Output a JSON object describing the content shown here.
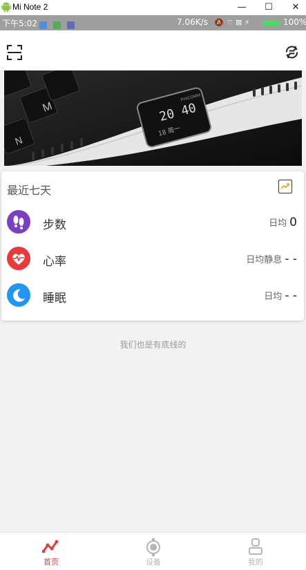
{
  "window": {
    "title": "Mi Note 2",
    "minimize": "—",
    "maximize": "☐",
    "close": "✕"
  },
  "status_bar": {
    "time": "下午5:02",
    "net_speed": "7.06K/s",
    "battery": "100%"
  },
  "summary": {
    "title": "最近七天",
    "rows": [
      {
        "label": "步数",
        "metric_label": "日均",
        "metric_value": "0",
        "color": "#7b3fc4"
      },
      {
        "label": "心率",
        "metric_label": "日均静息",
        "metric_value": "- -",
        "color": "#e83a3a"
      },
      {
        "label": "睡眠",
        "metric_label": "日均",
        "metric_value": "- -",
        "color": "#2196f3"
      }
    ]
  },
  "bottom_note": "我们也是有底线的",
  "banner": {
    "device_time": "20 40",
    "device_date": "18 周一",
    "brand": "PHICOMM"
  },
  "tabs": [
    {
      "label": "首页",
      "active": true,
      "icon": "home-pulse-icon"
    },
    {
      "label": "设备",
      "active": false,
      "icon": "device-icon"
    },
    {
      "label": "我的",
      "active": false,
      "icon": "profile-icon"
    }
  ],
  "colors": {
    "active_tab": "#e53935",
    "inactive_tab": "#b5b5b5"
  }
}
